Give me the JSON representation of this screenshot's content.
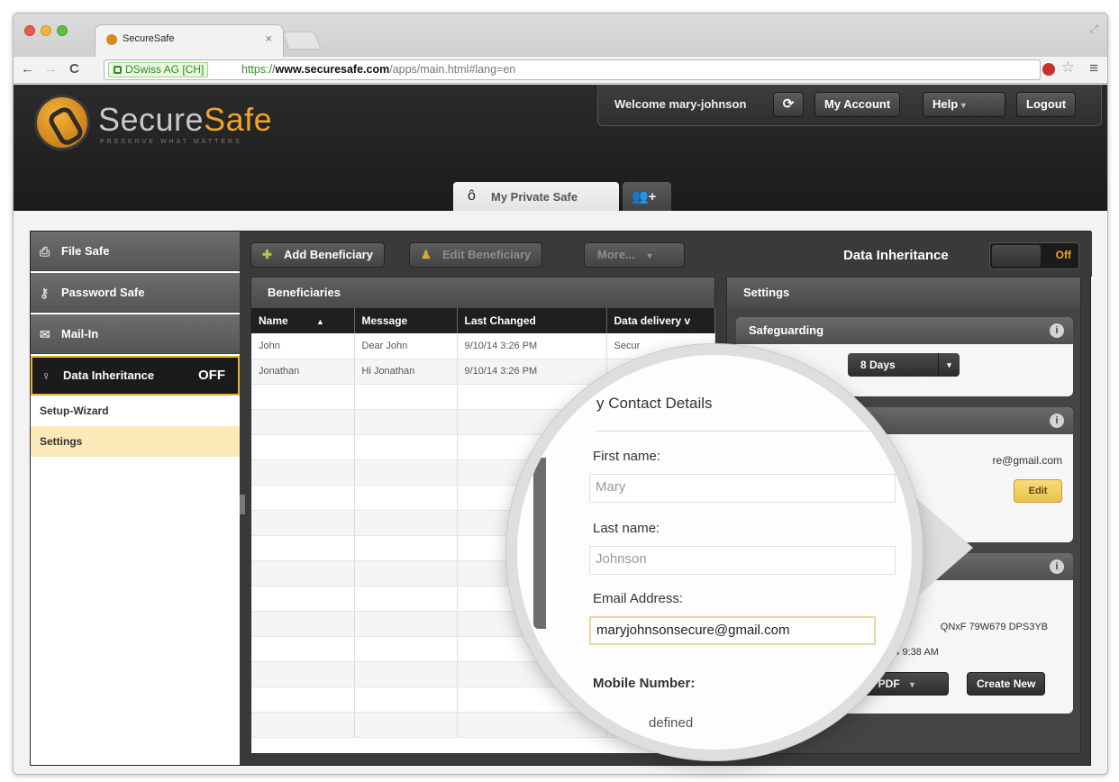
{
  "browser": {
    "tab_title": "SecureSafe",
    "tab_close": "×",
    "ev_badge": "DSwiss AG [CH]",
    "url_scheme": "https://",
    "url_domain": "www.securesafe.com",
    "url_path": "/apps/main.html#lang=en",
    "back": "←",
    "forward": "→",
    "reload": "C",
    "star": "☆",
    "menu": "≡"
  },
  "site": {
    "logo_part1": "Secure",
    "logo_part2": "Safe",
    "tagline": "PRESERVE WHAT MATTERS",
    "welcome": "Welcome mary-johnson",
    "refresh_icon": "⟳",
    "my_account": "My Account",
    "help": "Help",
    "logout": "Logout",
    "tabs": {
      "private_safe": "My Private Safe",
      "add_icon": "👥+"
    }
  },
  "sidebar": {
    "items": [
      {
        "label": "File Safe",
        "icon": "⎙"
      },
      {
        "label": "Password Safe",
        "icon": "⚷"
      },
      {
        "label": "Mail-In",
        "icon": "✉"
      }
    ],
    "active": {
      "label": "Data Inheritance",
      "state": "OFF",
      "icon": "♀"
    },
    "sub": [
      "Setup-Wizard",
      "Settings"
    ]
  },
  "toolbar": {
    "add_beneficiary": "Add Beneficiary",
    "edit_beneficiary": "Edit Beneficiary",
    "more": "More...",
    "data_inheritance": "Data Inheritance",
    "toggle_state": "Off"
  },
  "beneficiaries": {
    "title": "Beneficiaries",
    "columns": [
      "Name",
      "Message",
      "Last Changed",
      "Data delivery v"
    ],
    "rows": [
      [
        "John",
        "Dear John",
        "9/10/14 3:26 PM",
        "Secur"
      ],
      [
        "Jonathan",
        "Hi Jonathan",
        "9/10/14 3:26 PM",
        ""
      ]
    ]
  },
  "settings": {
    "title": "Settings",
    "safeguarding": "Safeguarding",
    "days": "8 Days",
    "email_partial": "re@gmail.com",
    "edit": "Edit",
    "code_partial": "QNxF 79W679 DPS3YB",
    "date_partial": "1/14 9:38 AM",
    "view_pdf": "iew PDF",
    "create_new": "Create New",
    "info": "i"
  },
  "contact": {
    "title": "y Contact Details",
    "first_name_label": "First name:",
    "first_name": "Mary",
    "last_name_label": "Last name:",
    "last_name": "Johnson",
    "email_label": "Email Address:",
    "email": "maryjohnsonsecure@gmail.com",
    "mobile_label": "Mobile Number:",
    "mobile_value": "defined"
  }
}
